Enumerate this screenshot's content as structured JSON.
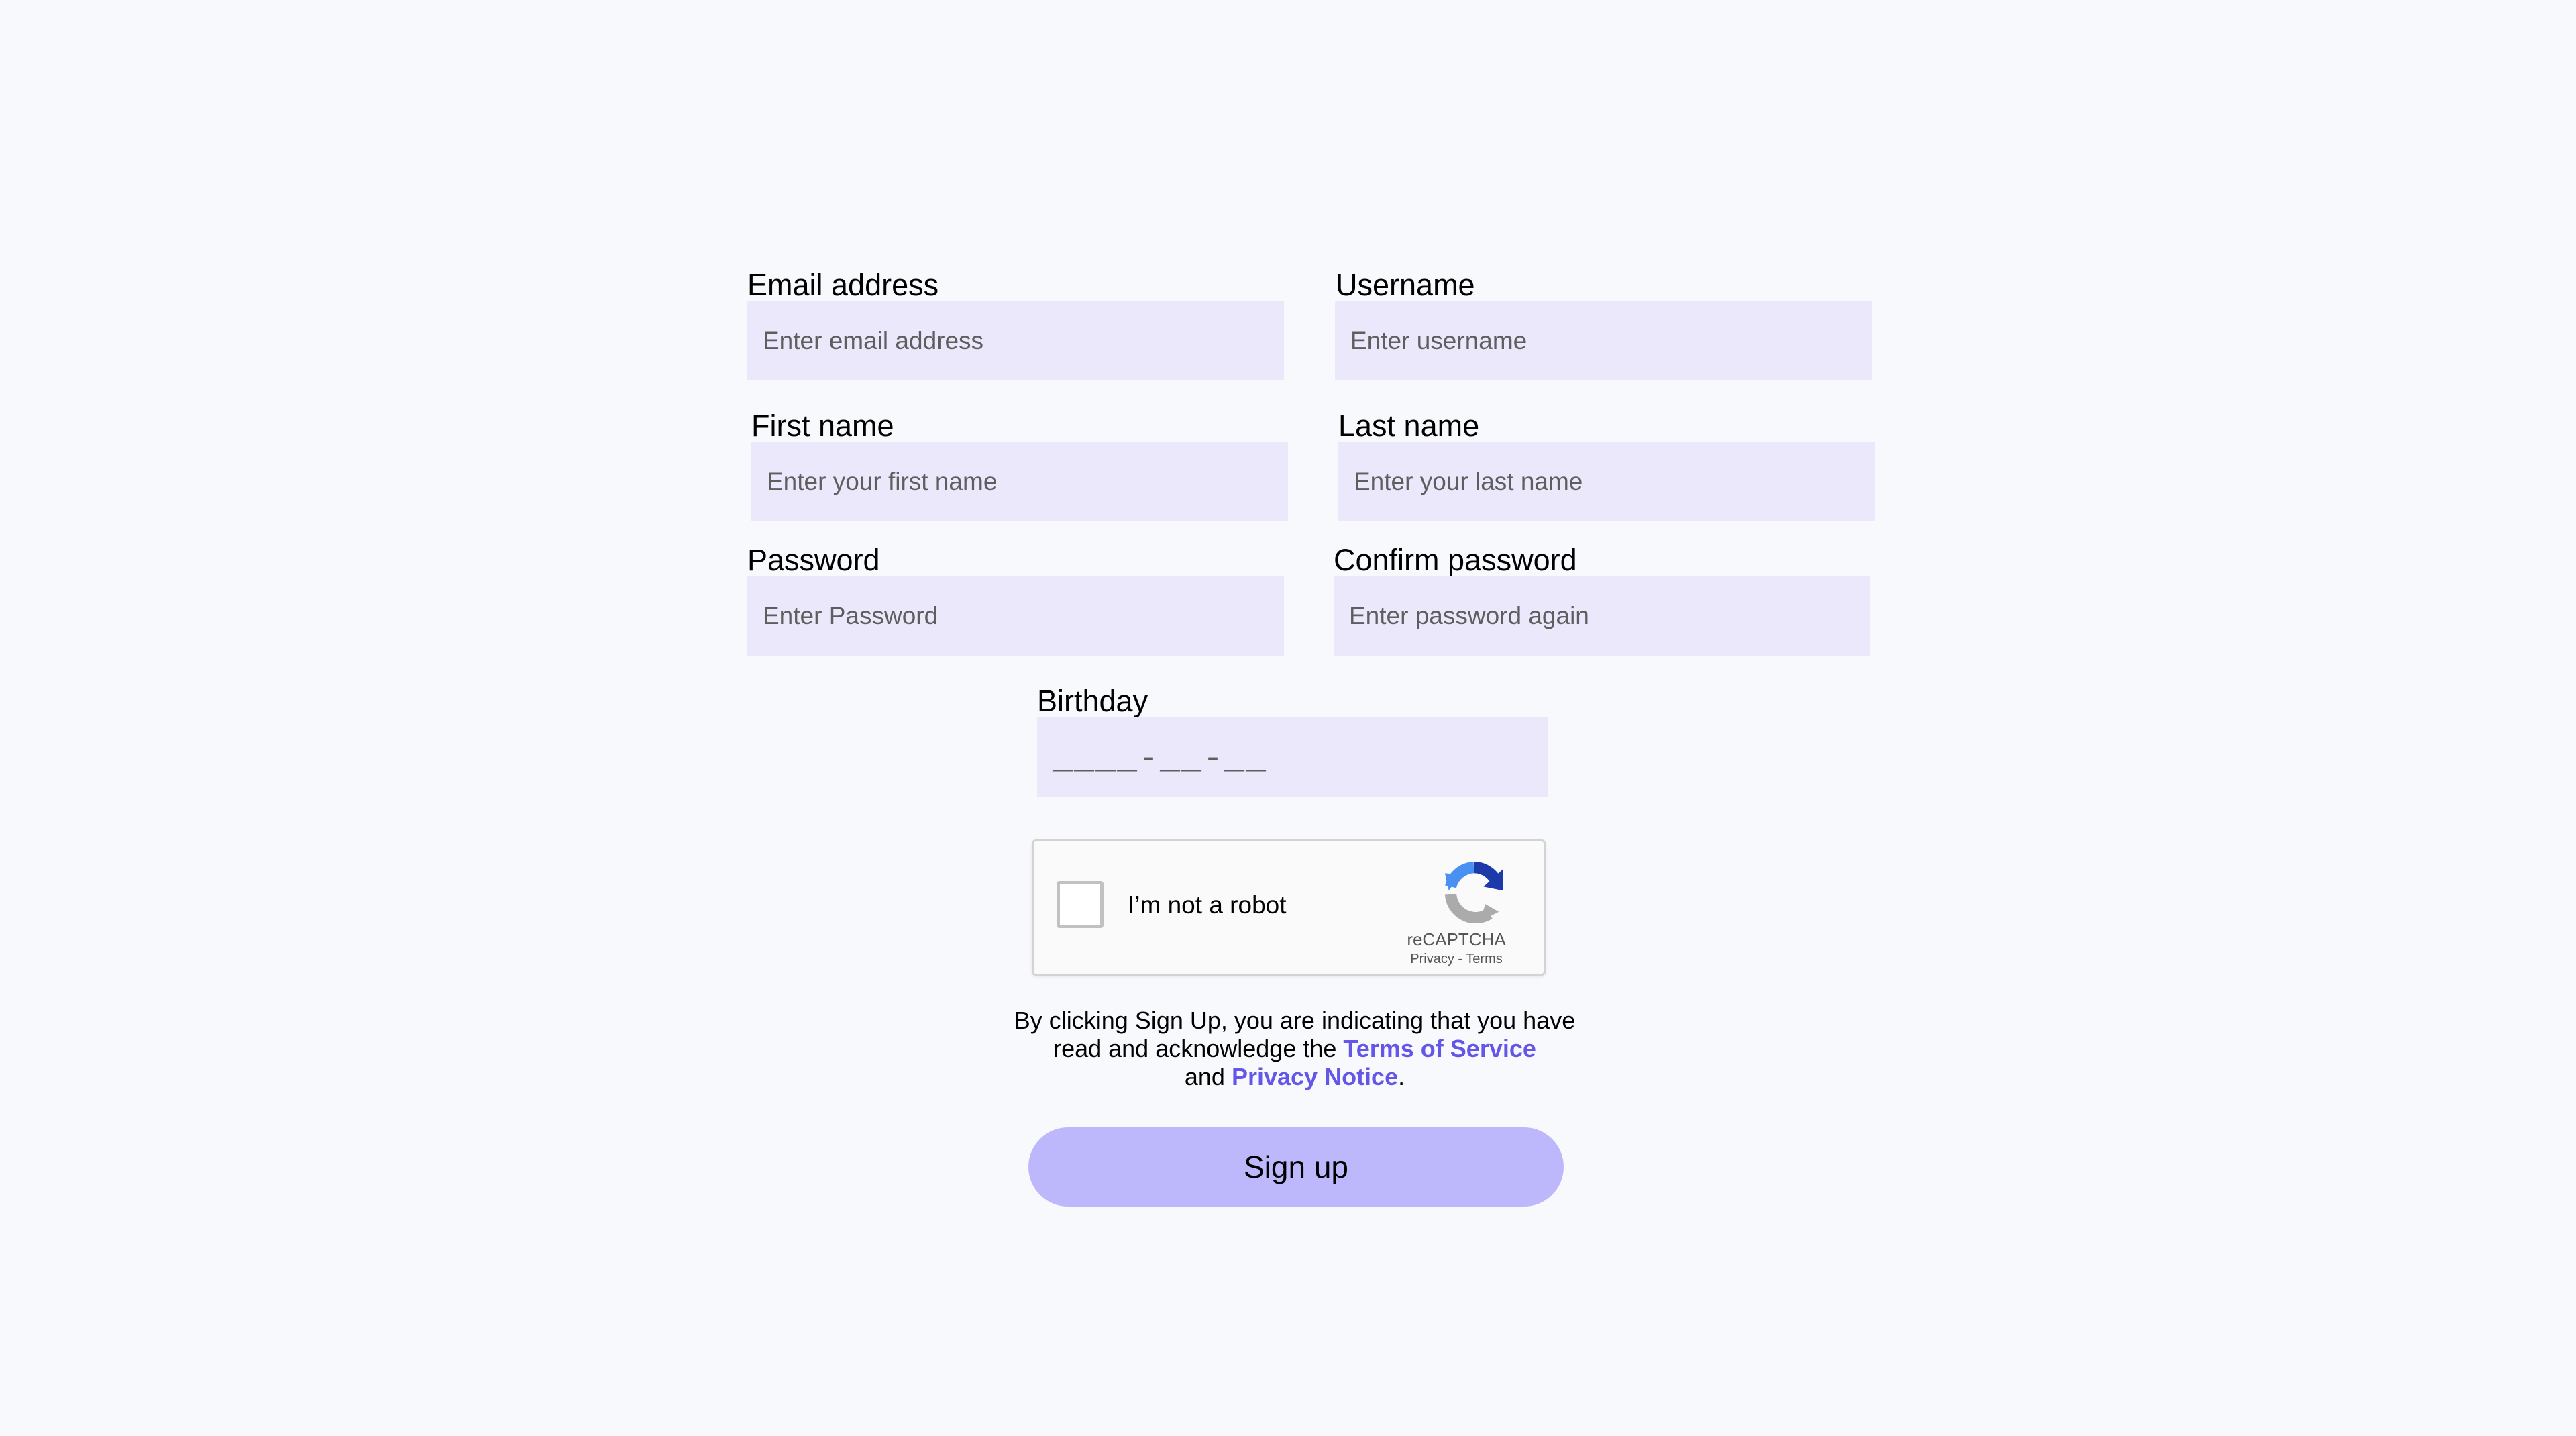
{
  "form": {
    "email": {
      "label": "Email address",
      "placeholder": "Enter email address"
    },
    "username": {
      "label": "Username",
      "placeholder": "Enter username"
    },
    "first_name": {
      "label": "First name",
      "placeholder": "Enter your first name"
    },
    "last_name": {
      "label": "Last name",
      "placeholder": "Enter your last name"
    },
    "password": {
      "label": "Password",
      "placeholder": "Enter Password"
    },
    "confirm_password": {
      "label": "Confirm password",
      "placeholder": "Enter password again"
    },
    "birthday": {
      "label": "Birthday",
      "mask": "____-__-__"
    }
  },
  "captcha": {
    "text": "I’m not a robot",
    "brand": "reCAPTCHA",
    "privacy": "Privacy",
    "separator": "-",
    "terms": "Terms",
    "icon": "recaptcha-icon"
  },
  "terms": {
    "line1": "By clicking Sign Up, you are indicating that you have read and acknowledge the",
    "terms_link": "Terms of Service",
    "and": "and",
    "privacy_link": "Privacy Notice",
    "period": "."
  },
  "signup_button": {
    "label": "Sign up"
  },
  "colors": {
    "background": "#f8f9fd",
    "field": "#ebe8fc",
    "link": "#6457e8",
    "button": "#bcb8fb"
  }
}
